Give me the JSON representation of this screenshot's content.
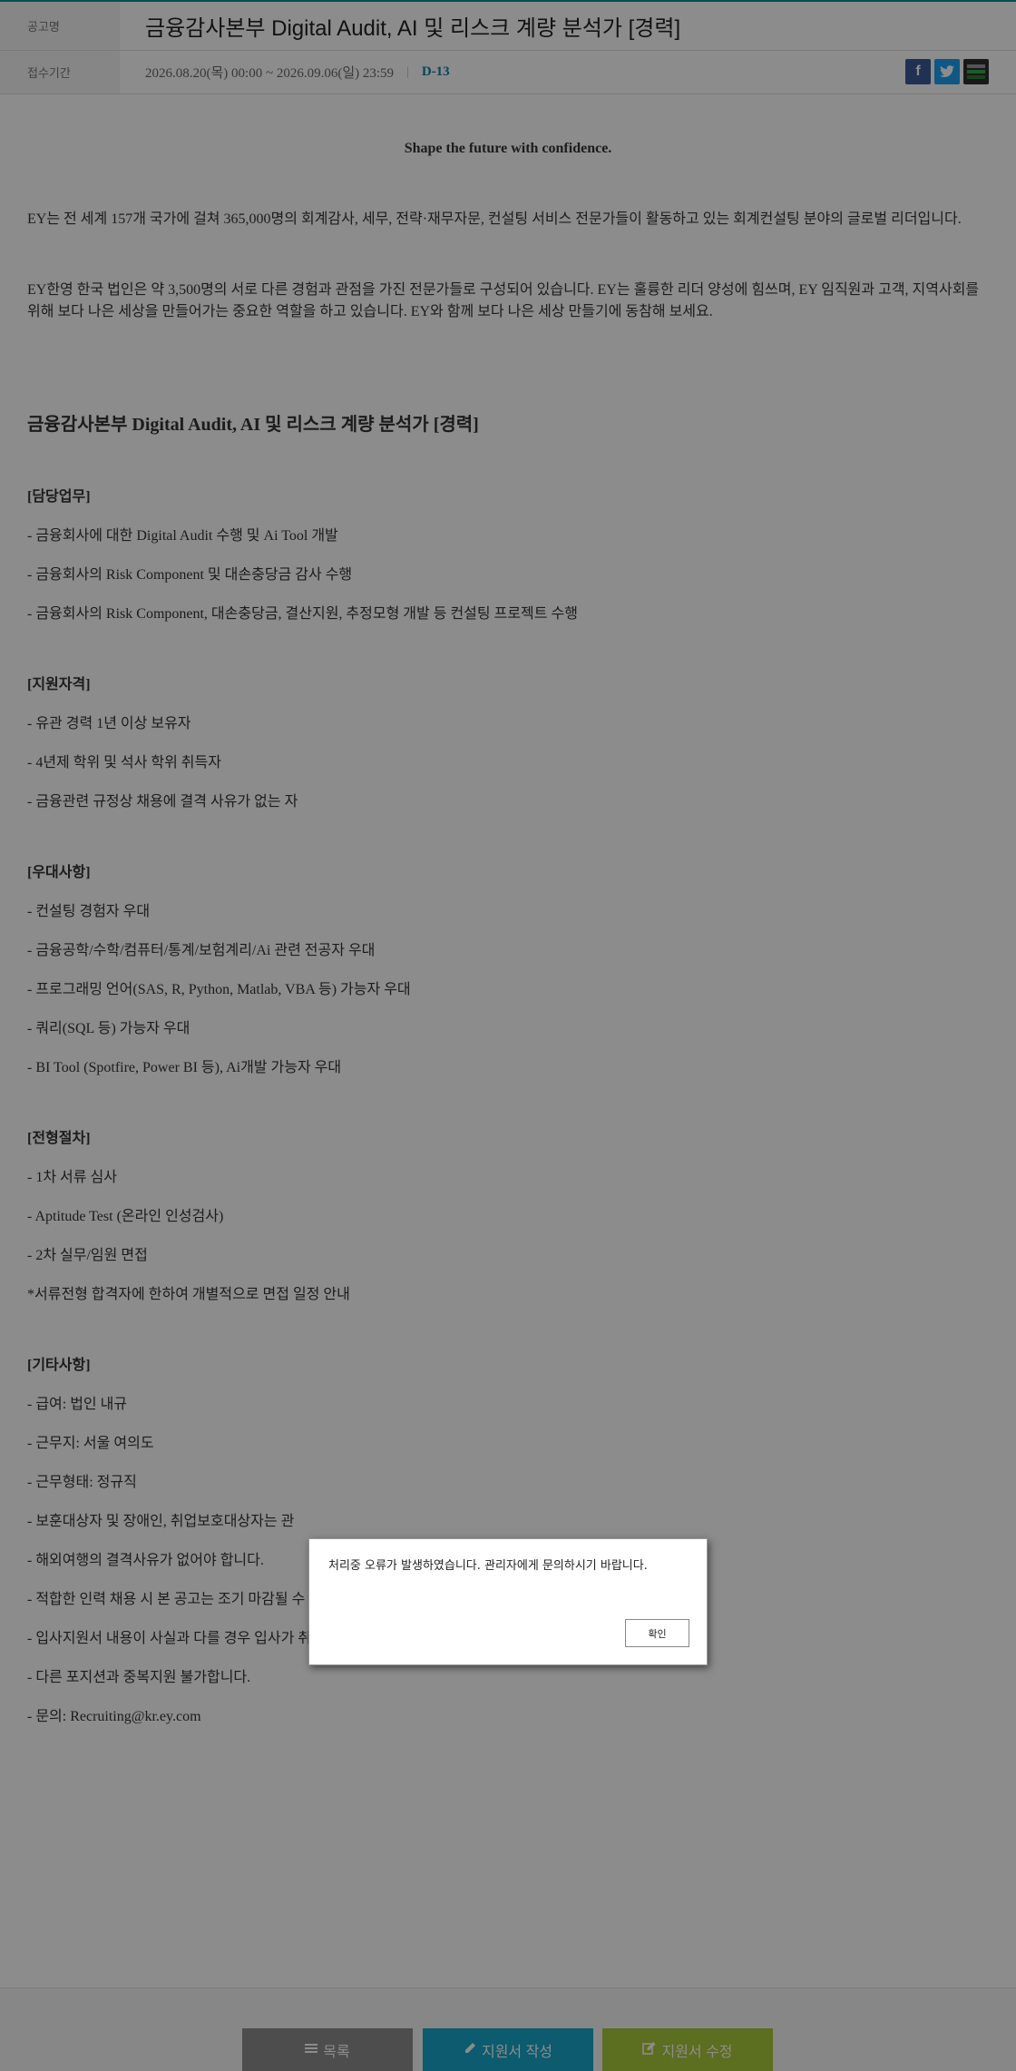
{
  "header": {
    "title_label": "공고명",
    "job_title": "금융감사본부 Digital Audit, AI 및 리스크 계량 분석가 [경력]",
    "period_label": "접수기간",
    "period_value": "2026.08.20(목) 00:00 ~ 2026.09.06(일) 23:59",
    "separator": "|",
    "dday": "D-13",
    "share": {
      "facebook_glyph": "f",
      "twitter_glyph": "t",
      "facebook_icon": "facebook-icon",
      "twitter_icon": "twitter-icon",
      "bookmark_icon": "bookmark-icon"
    }
  },
  "body": {
    "tagline": "Shape the future with confidence.",
    "intro1": "EY는 전 세계 157개 국가에 걸쳐 365,000명의 회계감사, 세무, 전략·재무자문, 컨설팅 서비스 전문가들이 활동하고 있는 회계컨설팅 분야의 글로벌 리더입니다.",
    "intro2": "EY한영 한국 법인은 약 3,500명의 서로 다른 경험과 관점을 가진 전문가들로 구성되어 있습니다. EY는 훌륭한 리더 양성에 힘쓰며, EY 임직원과 고객, 지역사회를 위해 보다 나은 세상을 만들어가는 중요한 역할을 하고 있습니다. EY와 함께 보다 나은 세상 만들기에 동참해 보세요.",
    "post_title": "금융감사본부 Digital Audit, AI 및 리스크 계량 분석가 [경력]",
    "sections": [
      {
        "title": "[담당업무]",
        "items": [
          "- 금융회사에 대한 Digital Audit 수행 및 Ai Tool 개발",
          "- 금융회사의 Risk Component 및 대손충당금 감사 수행",
          "- 금융회사의 Risk Component, 대손충당금, 결산지원, 추정모형 개발 등 컨설팅 프로젝트 수행"
        ]
      },
      {
        "title": "[지원자격]",
        "items": [
          "- 유관 경력 1년 이상 보유자",
          "- 4년제 학위 및 석사 학위 취득자",
          "- 금융관련 규정상 채용에 결격 사유가 없는 자"
        ]
      },
      {
        "title": "[우대사항]",
        "items": [
          "- 컨설팅 경험자 우대",
          "- 금융공학/수학/컴퓨터/통계/보험계리/Ai 관련 전공자 우대",
          "- 프로그래밍 언어(SAS, R, Python, Matlab, VBA 등) 가능자 우대",
          "- 쿼리(SQL 등) 가능자 우대",
          "- BI Tool (Spotfire, Power BI 등), Ai개발 가능자 우대"
        ]
      },
      {
        "title": "[전형절차]",
        "items": [
          "- 1차 서류 심사",
          "- Aptitude Test (온라인 인성검사)",
          "- 2차 실무/임원 면접",
          "*서류전형 합격자에 한하여 개별적으로 면접 일정 안내"
        ]
      },
      {
        "title": "[기타사항]",
        "items": [
          "- 급여: 법인 내규",
          "- 근무지: 서울 여의도",
          "- 근무형태: 정규직",
          "- 보훈대상자 및 장애인, 취업보호대상자는 관",
          "- 해외여행의 결격사유가 없어야 합니다.",
          "- 적합한 인력 채용 시 본 공고는 조기 마감될 수 있습니다.",
          "- 입사지원서 내용이 사실과 다를 경우 입사가 취소될 수 있습니다.",
          "- 다른 포지션과 중복지원 불가합니다.",
          "- 문의: Recruiting@kr.ey.com"
        ]
      }
    ]
  },
  "footer": {
    "list_label": "목록",
    "write_label": "지원서 작성",
    "edit_label": "지원서 수정",
    "list_icon": "list-icon",
    "write_icon": "pencil-icon",
    "edit_icon": "edit-icon"
  },
  "modal": {
    "message": "처리중 오류가 발생하였습니다. 관리자에게 문의하시기 바랍니다.",
    "confirm_label": "확인"
  },
  "colors": {
    "accent": "#0a7fa8",
    "write_button": "#17a6c8",
    "edit_button": "#a8c83a",
    "list_button": "#8c8c8c"
  }
}
